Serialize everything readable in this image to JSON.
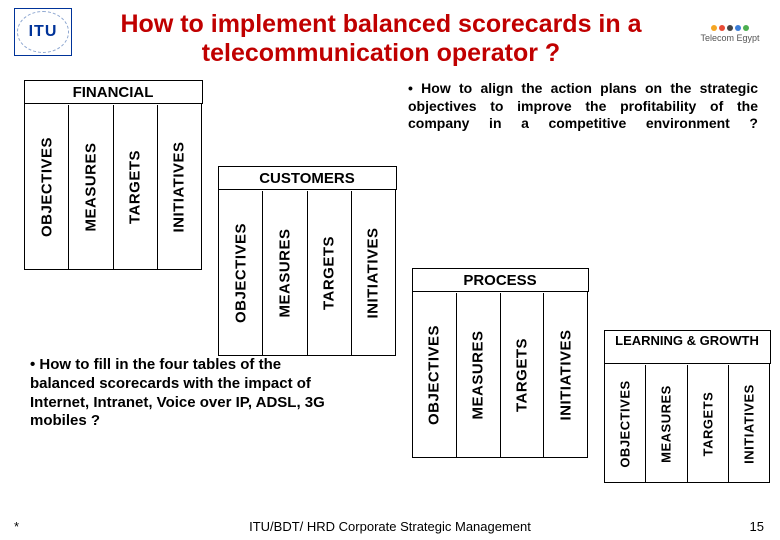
{
  "header": {
    "title": "How to implement balanced scorecards in a telecommunication operator ?",
    "itu_logo_text": "ITU",
    "te_logo_text": "Telecom Egypt"
  },
  "cards": {
    "financial": {
      "label": "FINANCIAL",
      "columns": [
        "OBJECTIVES",
        "MEASURES",
        "TARGETS",
        "INITIATIVES"
      ]
    },
    "customers": {
      "label": "CUSTOMERS",
      "columns": [
        "OBJECTIVES",
        "MEASURES",
        "TARGETS",
        "INITIATIVES"
      ]
    },
    "process": {
      "label": "PROCESS",
      "columns": [
        "OBJECTIVES",
        "MEASURES",
        "TARGETS",
        "INITIATIVES"
      ]
    },
    "learning": {
      "label": "LEARNING & GROWTH",
      "columns": [
        "OBJECTIVES",
        "MEASURES",
        "TARGETS",
        "INITIATIVES"
      ]
    }
  },
  "bullets": {
    "top": "• How to align the action plans on the strategic objectives to improve the profitability of the company in a competitive environment ?",
    "bottom": "• How to fill in the four tables of the balanced scorecards with the impact of Internet, Intranet,  Voice over IP, ADSL, 3G mobiles  ?"
  },
  "footer": {
    "left": "*",
    "center": "ITU/BDT/ HRD   Corporate Strategic Management",
    "page": "15"
  }
}
